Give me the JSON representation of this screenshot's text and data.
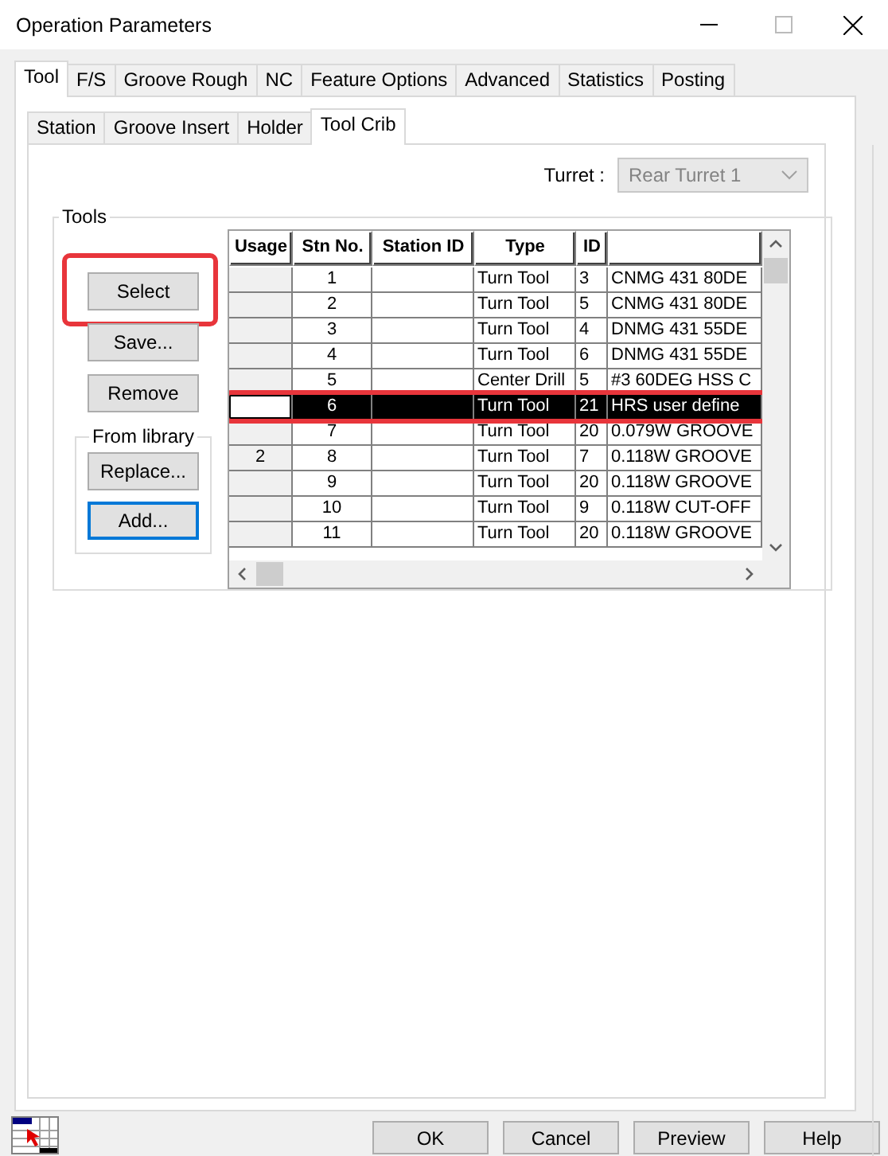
{
  "window": {
    "title": "Operation Parameters"
  },
  "tabs": [
    {
      "label": "Tool",
      "selected": true
    },
    {
      "label": "F/S",
      "selected": false
    },
    {
      "label": "Groove Rough",
      "selected": false
    },
    {
      "label": "NC",
      "selected": false
    },
    {
      "label": "Feature Options",
      "selected": false
    },
    {
      "label": "Advanced",
      "selected": false
    },
    {
      "label": "Statistics",
      "selected": false
    },
    {
      "label": "Posting",
      "selected": false
    }
  ],
  "subtabs": [
    {
      "label": "Station",
      "selected": false
    },
    {
      "label": "Groove Insert",
      "selected": false
    },
    {
      "label": "Holder",
      "selected": false
    },
    {
      "label": "Tool Crib",
      "selected": true
    }
  ],
  "turret": {
    "label": "Turret :",
    "value": "Rear Turret 1",
    "disabled": true
  },
  "tools_group": {
    "title": "Tools",
    "buttons": [
      {
        "label": "Select",
        "highlighted": true
      },
      {
        "label": "Save...",
        "highlighted": false
      },
      {
        "label": "Remove",
        "highlighted": false
      }
    ],
    "library": {
      "title": "From library",
      "buttons": [
        {
          "label": "Replace...",
          "default": false
        },
        {
          "label": "Add...",
          "default": true
        }
      ]
    }
  },
  "table": {
    "columns": [
      "Usage",
      "Stn No.",
      "Station ID",
      "Type",
      "ID"
    ],
    "rows": [
      {
        "stn": "1",
        "type": "Turn Tool",
        "id": "3",
        "column_6": "CNMG 431 80DE",
        "selected": false,
        "highlighted": false
      },
      {
        "stn": "2",
        "type": "Turn Tool",
        "id": "5",
        "column_6": "CNMG 431 80DE",
        "selected": false,
        "highlighted": false
      },
      {
        "stn": "3",
        "type": "Turn Tool",
        "id": "4",
        "column_6": "DNMG 431 55DE",
        "selected": false,
        "highlighted": false
      },
      {
        "stn": "4",
        "type": "Turn Tool",
        "id": "6",
        "column_6": "DNMG 431 55DE",
        "selected": false,
        "highlighted": false
      },
      {
        "stn": "5",
        "type": "Center Drill",
        "id": "5",
        "column_6": "#3 60DEG HSS C",
        "selected": false,
        "highlighted": false
      },
      {
        "stn": "6",
        "type": "Turn Tool",
        "id": "21",
        "column_6": "HRS user define",
        "selected": true,
        "highlighted": true
      },
      {
        "stn": "7",
        "type": "Turn Tool",
        "id": "20",
        "column_6": "0.079W GROOVE",
        "selected": false,
        "highlighted": false
      },
      {
        "usage": "2",
        "stn": "8",
        "type": "Turn Tool",
        "id": "7",
        "column_6": "0.118W GROOVE",
        "selected": false,
        "highlighted": false
      },
      {
        "stn": "9",
        "type": "Turn Tool",
        "id": "20",
        "column_6": "0.118W GROOVE",
        "selected": false,
        "highlighted": false
      },
      {
        "stn": "10",
        "type": "Turn Tool",
        "id": "9",
        "column_6": "0.118W CUT-OFF",
        "selected": false,
        "highlighted": false
      },
      {
        "stn": "11",
        "type": "Turn Tool",
        "id": "20",
        "column_6": "0.118W GROOVE",
        "selected": false,
        "highlighted": false
      }
    ]
  },
  "buttons": [
    "OK",
    "Cancel",
    "Preview",
    "Help"
  ]
}
